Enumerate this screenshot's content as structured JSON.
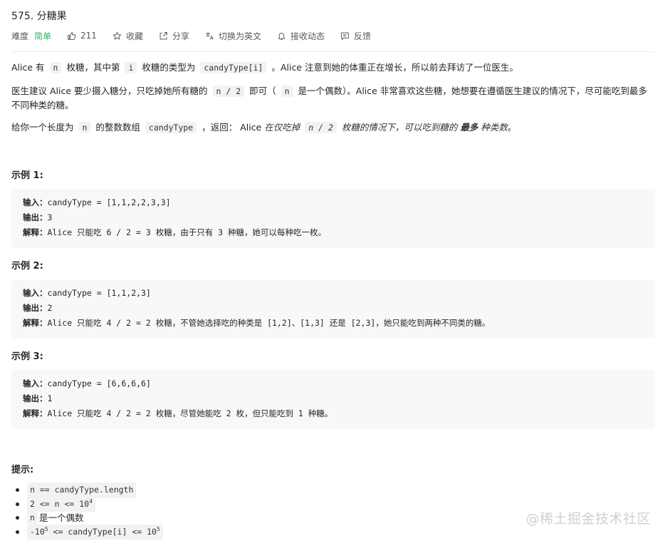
{
  "problem": {
    "title": "575. 分糖果"
  },
  "meta": {
    "difficulty_label": "难度",
    "difficulty_value": "简单",
    "likes": "211",
    "favorite": "收藏",
    "share": "分享",
    "switch_lang": "切换为英文",
    "notify": "接收动态",
    "feedback": "反馈",
    "colors": {
      "easy": "#2db55d",
      "text": "#262626",
      "muted": "#595959"
    }
  },
  "description": {
    "p1": {
      "a": "Alice 有",
      "b": "n",
      "c": "枚糖，其中第",
      "d": "i",
      "e": "枚糖的类型为",
      "f": "candyType[i]",
      "g": "。Alice 注意到她的体重正在增长，所以前去拜访了一位医生。"
    },
    "p2": {
      "a": "医生建议 Alice 要少摄入糖分，只吃掉她所有糖的",
      "b": "n / 2",
      "c": "即可（",
      "d": "n",
      "e": "是一个偶数）。Alice 非常喜欢这些糖，她想要在遵循医生建议的情况下，尽可能吃到最多不同种类的糖。"
    },
    "p3": {
      "a": "给你一个长度为",
      "b": "n",
      "c": "的整数数组",
      "d": "candyType",
      "e": "，返回： Alice",
      "f": "在仅吃掉",
      "g": "n / 2",
      "h": "枚糖的情况下，可以吃到糖的",
      "i": "最多",
      "j": "种类数",
      "k": "。"
    }
  },
  "examples": [
    {
      "heading": "示例 1:",
      "input_label": "输入：",
      "input": "candyType = [1,1,2,2,3,3]",
      "output_label": "输出：",
      "output": "3",
      "explain_label": "解释：",
      "explain": "Alice 只能吃 6 / 2 = 3 枚糖，由于只有 3 种糖，她可以每种吃一枚。"
    },
    {
      "heading": "示例 2:",
      "input_label": "输入：",
      "input": "candyType = [1,1,2,3]",
      "output_label": "输出：",
      "output": "2",
      "explain_label": "解释：",
      "explain": "Alice 只能吃 4 / 2 = 2 枚糖，不管她选择吃的种类是 [1,2]、[1,3] 还是 [2,3]，她只能吃到两种不同类的糖。"
    },
    {
      "heading": "示例 3:",
      "input_label": "输入：",
      "input": "candyType = [6,6,6,6]",
      "output_label": "输出：",
      "output": "1",
      "explain_label": "解释：",
      "explain": "Alice 只能吃 4 / 2 = 2 枚糖，尽管她能吃 2 枚，但只能吃到 1 种糖。"
    }
  ],
  "tips": {
    "heading": "提示:",
    "t1": "n == candyType.length",
    "t2_a": "2 <= n <= 10",
    "t2_sup": "4",
    "t3_a": "n",
    "t3_b": "是一个偶数",
    "t4_a": "-10",
    "t4_sup1": "5",
    "t4_b": "<= candyType[i] <= 10",
    "t4_sup2": "5"
  },
  "watermark": "@稀土掘金技术社区"
}
